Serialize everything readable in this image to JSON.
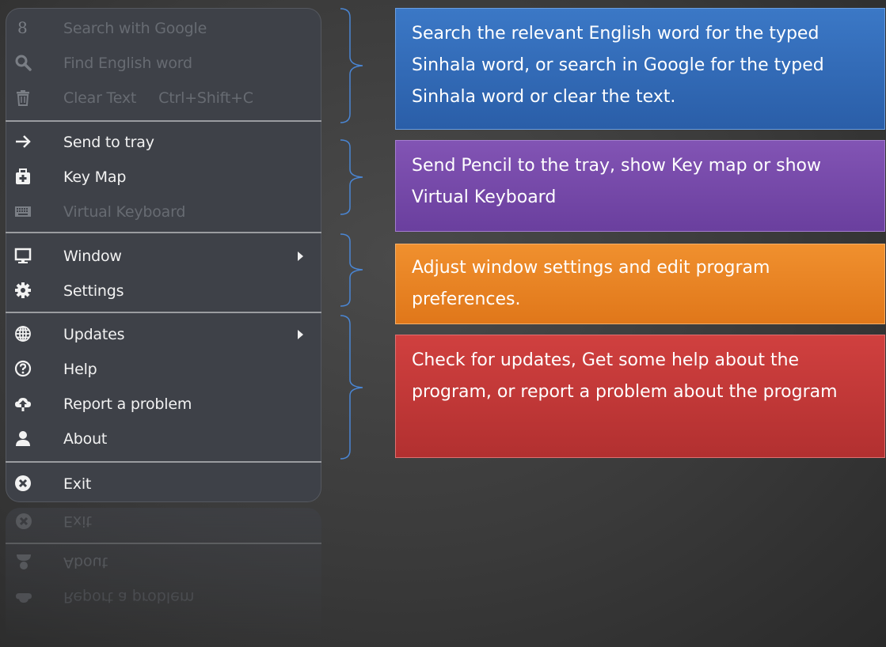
{
  "menu": {
    "items": [
      {
        "label": "Search with Google",
        "icon": "google-g-icon",
        "enabled": false
      },
      {
        "label": "Find English word",
        "icon": "search-icon",
        "enabled": false
      },
      {
        "label": "Clear Text",
        "shortcut": "Ctrl+Shift+C",
        "icon": "trash-icon",
        "enabled": false
      },
      {
        "label": "Send to tray",
        "icon": "arrow-right-icon",
        "enabled": true
      },
      {
        "label": "Key Map",
        "icon": "medkit-icon",
        "enabled": true
      },
      {
        "label": "Virtual Keyboard",
        "icon": "keyboard-icon",
        "enabled": false
      },
      {
        "label": "Window",
        "icon": "monitor-icon",
        "enabled": true,
        "submenu": true
      },
      {
        "label": "Settings",
        "icon": "gear-icon",
        "enabled": true
      },
      {
        "label": "Updates",
        "icon": "globe-icon",
        "enabled": true,
        "submenu": true
      },
      {
        "label": "Help",
        "icon": "question-icon",
        "enabled": true
      },
      {
        "label": "Report a problem",
        "icon": "cloud-upload-icon",
        "enabled": true
      },
      {
        "label": "About",
        "icon": "user-icon",
        "enabled": true
      },
      {
        "label": "Exit",
        "icon": "close-circle-icon",
        "enabled": true
      }
    ]
  },
  "reflection": {
    "items": [
      "Exit",
      "About",
      "Report a problem"
    ]
  },
  "callouts": [
    {
      "text": "Search the relevant English word for the typed Sinhala word, or search in Google for the typed Sinhala word or clear the text.",
      "color": "#2f67b3"
    },
    {
      "text": "Send Pencil to the tray, show Key map or show Virtual Keyboard",
      "color": "#7549a8"
    },
    {
      "text": "Adjust window settings and edit program preferences.",
      "color": "#ea8424"
    },
    {
      "text": "Check for updates, Get some help about the program, or report a problem about the program",
      "color": "#c03636"
    }
  ],
  "colors": {
    "background": "#3a3a3a",
    "menu": "#3e4148",
    "disabled_text": "#676b72",
    "brace": "#4a86d4"
  }
}
